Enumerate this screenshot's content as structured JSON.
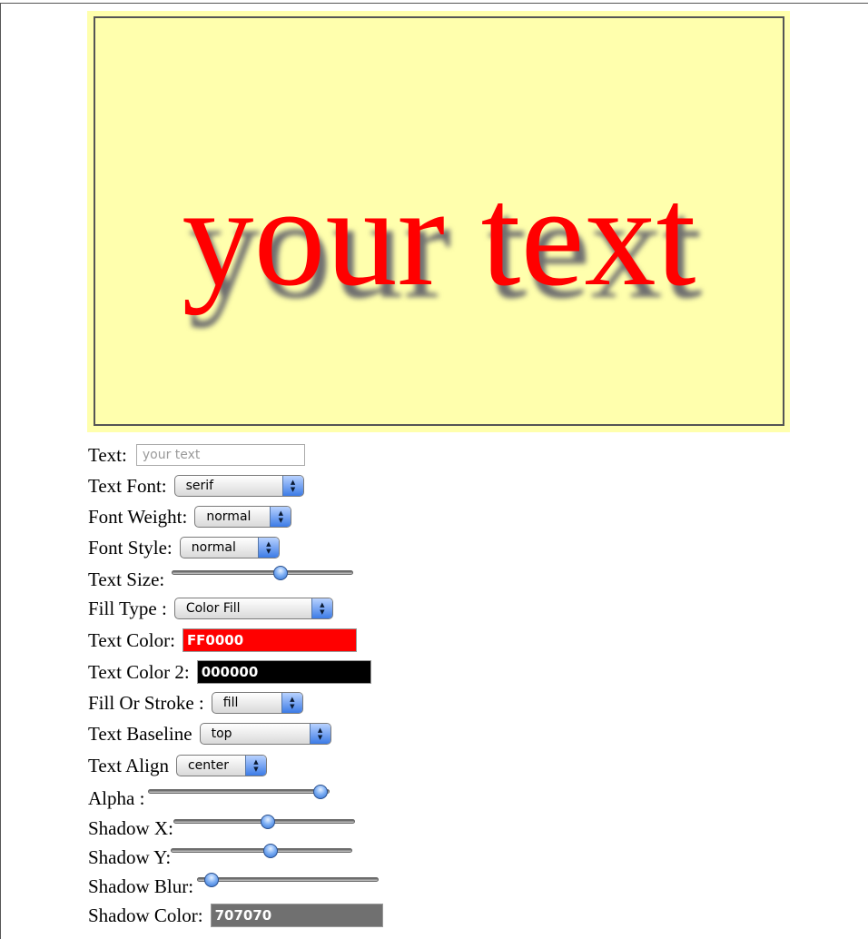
{
  "canvas": {
    "text": "your text",
    "text_color": "#FF0000",
    "background": "#FFFFAD",
    "border_color": "#555555",
    "shadow_color": "#707070"
  },
  "controls": {
    "text": {
      "label": "Text:",
      "value": "",
      "placeholder": "your text"
    },
    "text_font": {
      "label": "Text Font:",
      "value": "serif"
    },
    "font_weight": {
      "label": "Font Weight:",
      "value": "normal"
    },
    "font_style": {
      "label": "Font Style:",
      "value": "normal"
    },
    "text_size": {
      "label": "Text Size:",
      "fraction": 0.6
    },
    "fill_type": {
      "label": "Fill Type :",
      "value": "Color Fill"
    },
    "text_color": {
      "label": "Text Color:",
      "value": "FF0000",
      "color": "#FF0000"
    },
    "text_color_2": {
      "label": "Text Color 2:",
      "value": "000000",
      "color": "#000000"
    },
    "fill_or_stroke": {
      "label": "Fill Or Stroke :",
      "value": "fill"
    },
    "text_baseline": {
      "label": "Text Baseline",
      "value": "top"
    },
    "text_align": {
      "label": "Text Align",
      "value": "center"
    },
    "alpha": {
      "label": "Alpha :",
      "fraction": 0.95
    },
    "shadow_x": {
      "label": "Shadow X:",
      "fraction": 0.52
    },
    "shadow_y": {
      "label": "Shadow Y:",
      "fraction": 0.55
    },
    "shadow_blur": {
      "label": "Shadow Blur:",
      "fraction": 0.08
    },
    "shadow_color": {
      "label": "Shadow Color:",
      "value": "707070",
      "color": "#707070"
    }
  },
  "icons": {
    "select_arrows": "up-down-arrows-icon",
    "slider_knob": "slider-knob-icon"
  }
}
